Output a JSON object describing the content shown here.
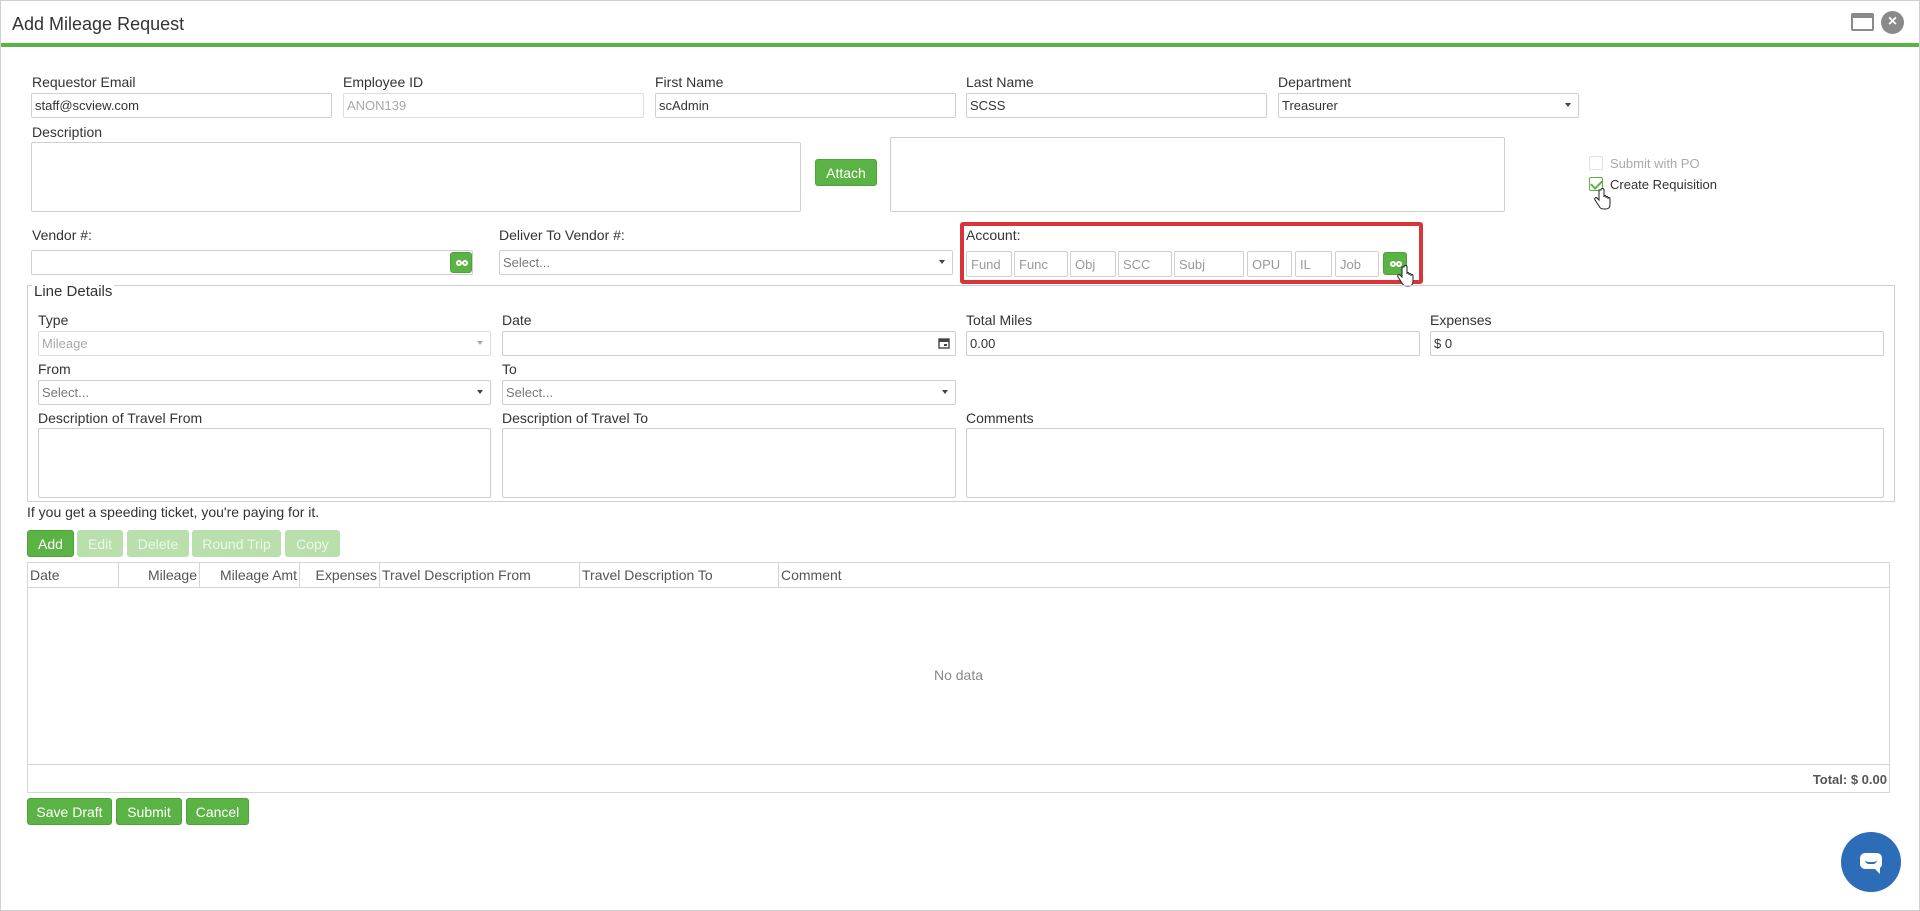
{
  "window": {
    "title": "Add Mileage Request"
  },
  "requestor": {
    "email_label": "Requestor Email",
    "email_value": "staff@scview.com",
    "employee_id_label": "Employee ID",
    "employee_id_value": "ANON139",
    "first_name_label": "First Name",
    "first_name_value": "scAdmin",
    "last_name_label": "Last Name",
    "last_name_value": "SCSS",
    "department_label": "Department",
    "department_value": "Treasurer"
  },
  "description": {
    "label": "Description",
    "attach_label": "Attach"
  },
  "options": {
    "submit_with_po_label": "Submit with PO",
    "submit_with_po_checked": false,
    "create_requisition_label": "Create Requisition",
    "create_requisition_checked": true
  },
  "vendor": {
    "vendor_label": "Vendor #:",
    "deliver_label": "Deliver To Vendor #:",
    "deliver_placeholder": "Select..."
  },
  "account": {
    "label": "Account:",
    "fields": [
      "Fund",
      "Func",
      "Obj",
      "SCC",
      "Subj",
      "OPU",
      "IL",
      "Job"
    ]
  },
  "line_details": {
    "legend": "Line Details",
    "type_label": "Type",
    "type_value": "Mileage",
    "date_label": "Date",
    "total_miles_label": "Total Miles",
    "total_miles_value": "0.00",
    "expenses_label": "Expenses",
    "expenses_value": "$ 0",
    "from_label": "From",
    "from_placeholder": "Select...",
    "to_label": "To",
    "to_placeholder": "Select...",
    "desc_from_label": "Description of Travel From",
    "desc_to_label": "Description of Travel To",
    "comments_label": "Comments"
  },
  "notice": "If you get a speeding ticket, you're paying for it.",
  "grid_toolbar": {
    "add": "Add",
    "edit": "Edit",
    "delete": "Delete",
    "round_trip": "Round Trip",
    "copy": "Copy"
  },
  "grid": {
    "columns": [
      "Date",
      "Mileage",
      "Mileage Amt",
      "Expenses",
      "Travel Description From",
      "Travel Description To",
      "Comment"
    ],
    "empty_text": "No data",
    "total_text": "Total: $ 0.00"
  },
  "footer": {
    "save_draft": "Save Draft",
    "submit": "Submit",
    "cancel": "Cancel"
  },
  "colors": {
    "accent": "#5cb345",
    "highlight": "#d9343a",
    "chat": "#2d6db8"
  }
}
